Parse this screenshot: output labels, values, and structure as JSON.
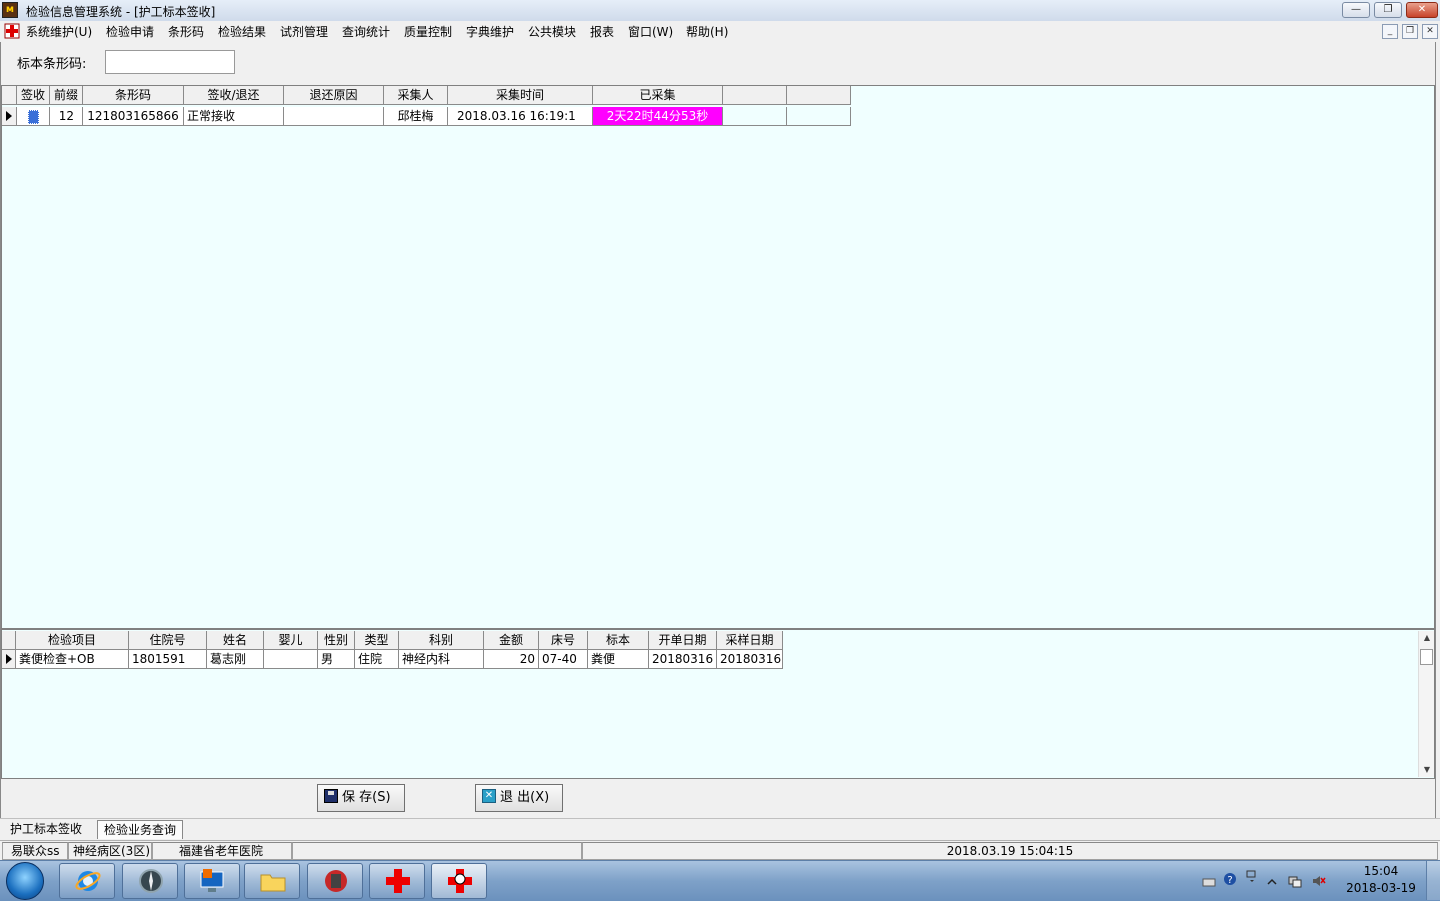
{
  "window": {
    "title": "检验信息管理系统 - [护工标本签收]",
    "min_glyph": "—",
    "max_glyph": "❐",
    "close_glyph": "✕",
    "mdi_min": "_",
    "mdi_restore": "❐",
    "mdi_close": "✕"
  },
  "menu": [
    "系统维护(U)",
    "检验申请",
    "条形码",
    "检验结果",
    "试剂管理",
    "查询统计",
    "质量控制",
    "字典维护",
    "公共模块",
    "报表",
    "窗口(W)",
    "帮助(H)"
  ],
  "barcode": {
    "label": "标本条形码:",
    "value": ""
  },
  "grid1": {
    "headers": [
      "签收",
      "前缀",
      "条形码",
      "签收/退还",
      "退还原因",
      "采集人",
      "采集时间",
      "已采集",
      "",
      ""
    ],
    "rows": [
      [
        "",
        "12",
        "121803165866",
        "正常接收",
        "",
        "邱桂梅",
        "2018.03.16 16:19:1",
        "2天22时44分53秒",
        "",
        ""
      ]
    ],
    "highlight_color": "#ff00ff"
  },
  "grid2": {
    "headers": [
      "检验项目",
      "住院号",
      "姓名",
      "婴儿",
      "性别",
      "类型",
      "科别",
      "金额",
      "床号",
      "标本",
      "开单日期",
      "采样日期"
    ],
    "rows": [
      [
        "粪便检查+OB",
        "1801591",
        "葛志刚",
        "",
        "男",
        "住院",
        "神经内科",
        "20",
        "07-40",
        "粪便",
        "20180316",
        "20180316"
      ]
    ]
  },
  "buttons": {
    "save": "保 存(S)",
    "exit": "退 出(X)"
  },
  "tabs": [
    "护工标本签收",
    "检验业务查询"
  ],
  "statusbar": {
    "user": "易联众ss",
    "ward": "神经病区(3区)",
    "hospital": "福建省老年医院",
    "empty1": "",
    "empty2": "",
    "datetime": "2018.03.19 15:04:15"
  },
  "taskbar": {
    "time": "15:04",
    "date": "2018-03-19"
  }
}
